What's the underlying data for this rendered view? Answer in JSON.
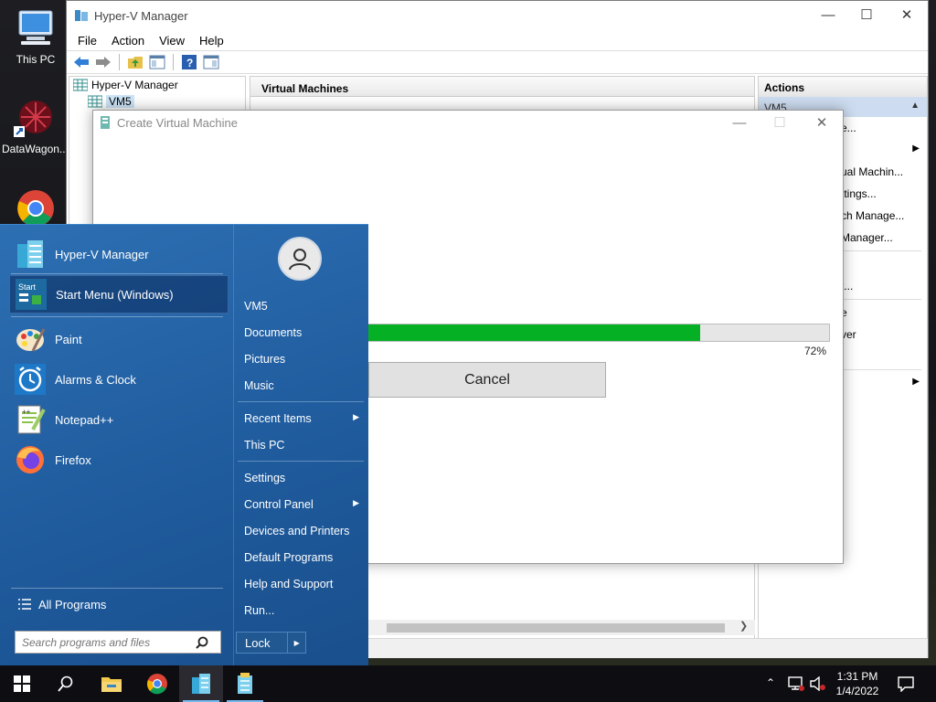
{
  "desktop": {
    "icons": [
      {
        "label": "This PC",
        "icon": "computer-icon"
      },
      {
        "label": "DataWagon...",
        "icon": "datawagon-shortcut-icon"
      },
      {
        "label": "",
        "icon": "chrome-icon"
      }
    ]
  },
  "hyperv": {
    "title": "Hyper-V Manager",
    "menu": [
      "File",
      "Action",
      "View",
      "Help"
    ],
    "tree": {
      "root": "Hyper-V Manager",
      "child": "VM5"
    },
    "center_header": "Virtual Machines",
    "actions_header": "Actions",
    "actions_selected": "VM5",
    "actions_items": [
      "e...",
      "",
      "ual Machin...",
      "ttings...",
      "ch Manage...",
      " Manager...",
      "",
      "t...",
      "e",
      "ver",
      ""
    ]
  },
  "dialog": {
    "title": "Create Virtual Machine",
    "progress": 0.72,
    "progress_text": "72%",
    "cancel_label": "Cancel"
  },
  "start_menu": {
    "programs": [
      {
        "label": "Hyper-V Manager",
        "icon": "hyperv-icon"
      },
      {
        "label": "Start Menu (Windows)",
        "icon": "start-menu-icon"
      },
      {
        "label": "Paint",
        "icon": "paint-icon"
      },
      {
        "label": "Alarms & Clock",
        "icon": "alarm-clock-icon"
      },
      {
        "label": "Notepad++",
        "icon": "notepadpp-icon"
      },
      {
        "label": "Firefox",
        "icon": "firefox-icon"
      }
    ],
    "all_programs": "All Programs",
    "search_placeholder": "Search programs and files",
    "user": "VM5",
    "right_items": [
      "Documents",
      "Pictures",
      "Music",
      "Recent Items",
      "This PC",
      "Settings",
      "Control Panel",
      "Devices and Printers",
      "Default Programs",
      "Help and Support",
      "Run..."
    ],
    "lock_label": "Lock"
  },
  "taskbar": {
    "time": "1:31 PM",
    "date": "1/4/2022"
  },
  "colors": {
    "accent": "#1e5a9c",
    "progress_green": "#06b025",
    "taskbar": "#0e0e12"
  }
}
